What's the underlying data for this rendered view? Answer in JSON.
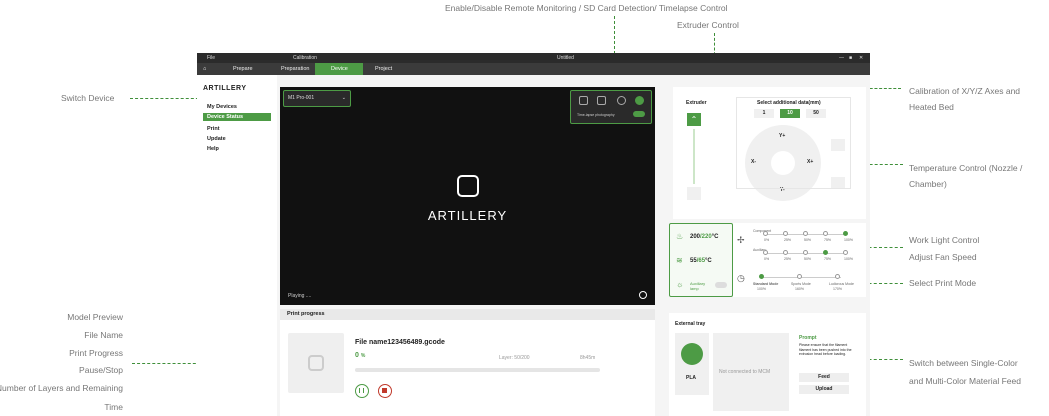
{
  "annotations": {
    "remote_monitoring": "Enable/Disable Remote Monitoring / SD Card Detection/ Timelapse Control",
    "extruder_control": "Extruder Control",
    "switch_device": "Switch Device",
    "calibration_line1": "Calibration of X/Y/Z Axes and",
    "calibration_line2": "Heated Bed",
    "temperature_line1": "Temperature Control (Nozzle /",
    "temperature_line2": "Chamber)",
    "work_light": "Work Light Control",
    "adjust_fan": "Adjust Fan Speed",
    "select_mode": "Select Print Mode",
    "model_preview": "Model Preview",
    "file_name": "File Name",
    "print_progress": "Print Progress",
    "pause_stop": "Pause/Stop",
    "layers_remaining_line1": "Number of Layers and Remaining",
    "layers_remaining_line2": "Time",
    "switch_material_line1": "Switch between Single-Color",
    "switch_material_line2": "and Multi-Color Material Feed"
  },
  "titlebar": {
    "file": "File",
    "calibration": "Calibration",
    "window_title": "Untitled"
  },
  "nav": {
    "prepare": "Prepare",
    "preparation": "Preparation",
    "device": "Device",
    "project": "Project"
  },
  "sidebar": {
    "logo": "ARTILLERY",
    "items": [
      "My Devices",
      "Device Status",
      "Print",
      "Update",
      "Help"
    ]
  },
  "preview": {
    "device_name": "M1 Pro-001",
    "timelapse_label": "Time-lapse photography",
    "brand": "ARTILLERY",
    "status": "Playing ...."
  },
  "print_progress": {
    "title": "Print progress",
    "file_name": "File name123456489.gcode",
    "percent": "0",
    "percent_unit": "%",
    "layer_label": "Layer:",
    "layer_value": "50/200",
    "time_remaining": "8h45m",
    "progress_fraction": 0
  },
  "extruder": {
    "label": "Extruder",
    "select_label": "Select additional data(mm)",
    "steps": [
      "1",
      "10",
      "50"
    ],
    "active_step": "10",
    "y_plus": "Y+",
    "y_minus": "Y-",
    "x_plus": "X+",
    "x_minus": "X-"
  },
  "temperature": {
    "nozzle_current": "200",
    "nozzle_target": "/220",
    "chamber_current": "55",
    "chamber_target": "/65",
    "unit": "°C",
    "aux_lamp": "Auxiliary lamp",
    "fan_component": "Component",
    "fan_auxiliary": "Auxiliary",
    "fan_steps": [
      "0%",
      "25%",
      "50%",
      "75%",
      "100%"
    ],
    "modes": [
      "Standard Mode",
      "Sports Mode",
      "Ludicrous Mode"
    ],
    "mode_speeds": [
      "100%",
      "160%",
      "170%"
    ]
  },
  "tray": {
    "title": "External tray",
    "filament": "PLA",
    "not_connected": "Not connected to MCM",
    "prompt_title": "Prompt",
    "prompt_text": "Please ensure that the filament filament has been pushed into the extrusion head before loading.",
    "feed": "Feed",
    "upload": "Upload"
  },
  "colors": {
    "accent": "#4d9b45",
    "stop": "#c0392b"
  }
}
